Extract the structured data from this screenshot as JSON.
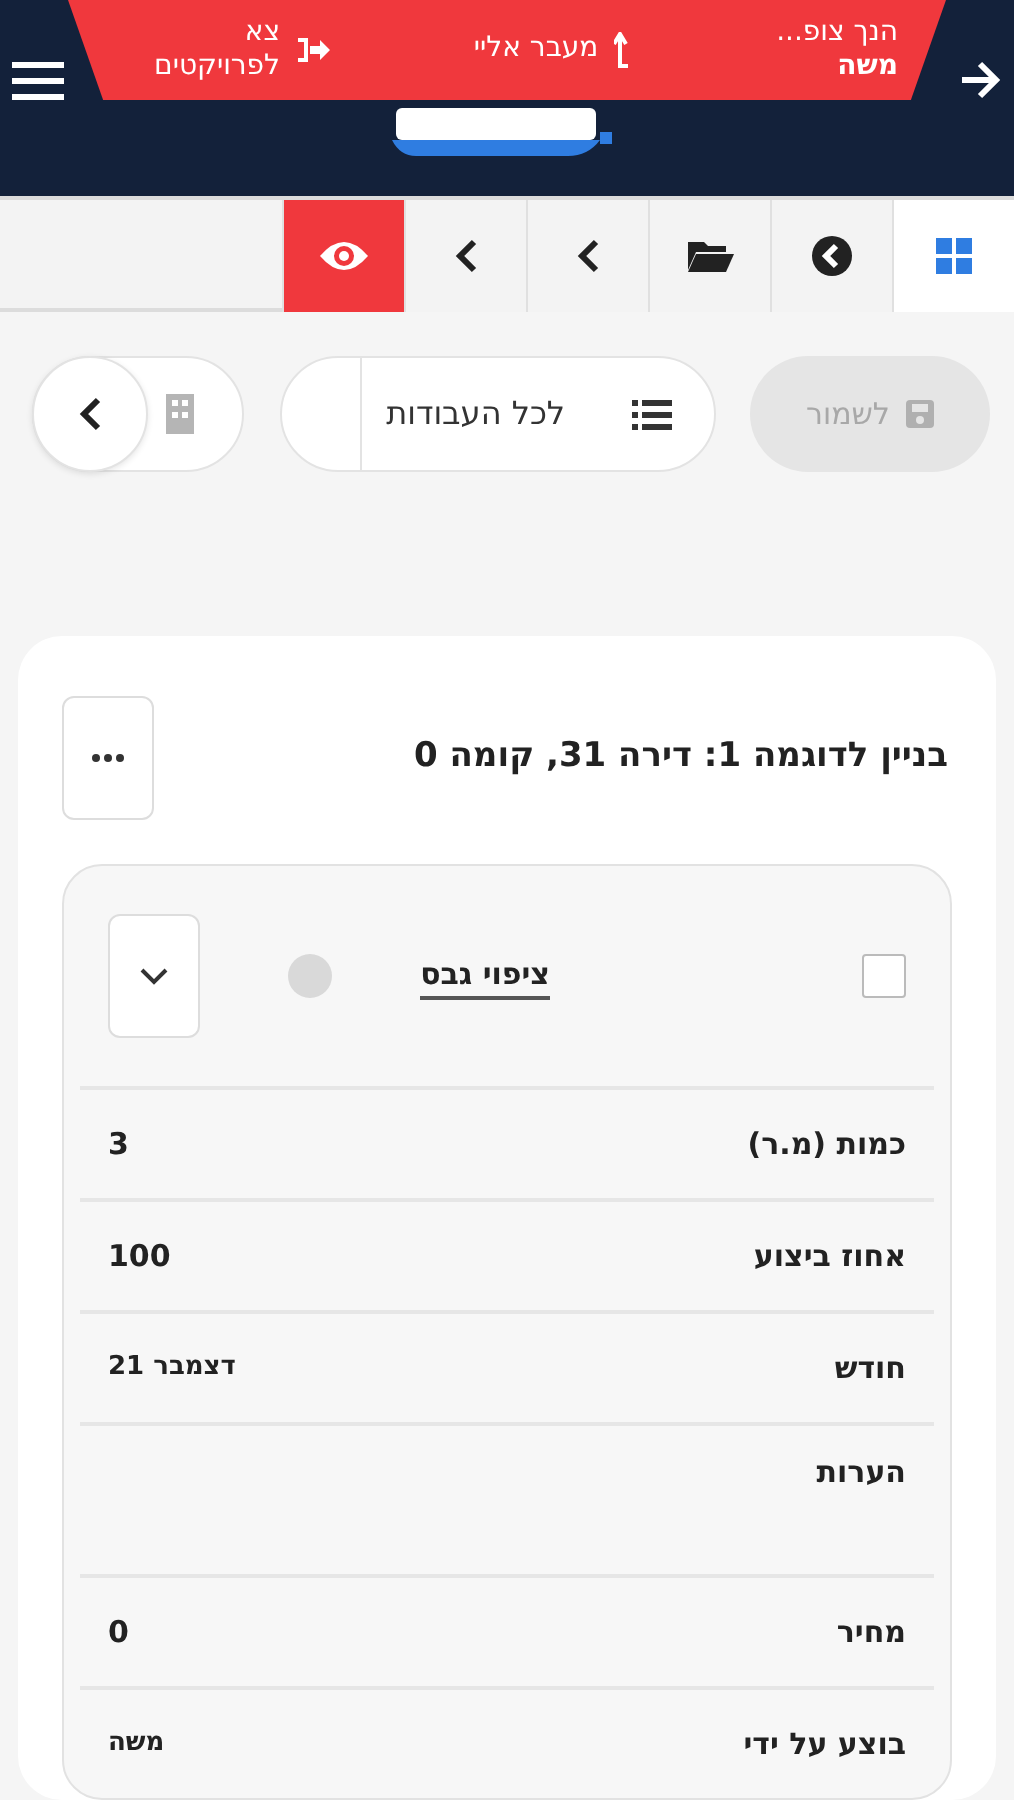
{
  "banner": {
    "viewing_label": "הנך צופ...",
    "viewing_user": "משה",
    "switch_label": "מעבר אליי",
    "exit_label": "צא לפרויקטים"
  },
  "tabs": [
    {
      "kind": "grid",
      "selected": true,
      "on": false
    },
    {
      "kind": "circle",
      "selected": false,
      "on": false
    },
    {
      "kind": "folder",
      "selected": false,
      "on": false
    },
    {
      "kind": "chevron",
      "selected": false,
      "on": false
    },
    {
      "kind": "chevron",
      "selected": false,
      "on": false
    },
    {
      "kind": "eye",
      "selected": false,
      "on": true
    }
  ],
  "toolbar": {
    "save": {
      "label": "לשמור",
      "disabled": true
    },
    "all_jobs": {
      "label": "לכל העבודות"
    }
  },
  "card": {
    "title": "בניין לדוגמה 1: דירה 31, קומה 0",
    "task": {
      "name": "ציפוי גבס",
      "checked": false,
      "expanded": false
    },
    "fields": [
      {
        "label": "כמות (מ.ר)",
        "value": "3"
      },
      {
        "label": "אחוז ביצוע",
        "value": "100"
      },
      {
        "label": "חודש",
        "value": "דצמבר 21",
        "kind": "small"
      },
      {
        "label": "הערות",
        "kind": "notes"
      },
      {
        "label": "מחיר",
        "value": "0"
      },
      {
        "label": "בוצע על ידי",
        "value": "משה",
        "kind": "small"
      }
    ]
  }
}
